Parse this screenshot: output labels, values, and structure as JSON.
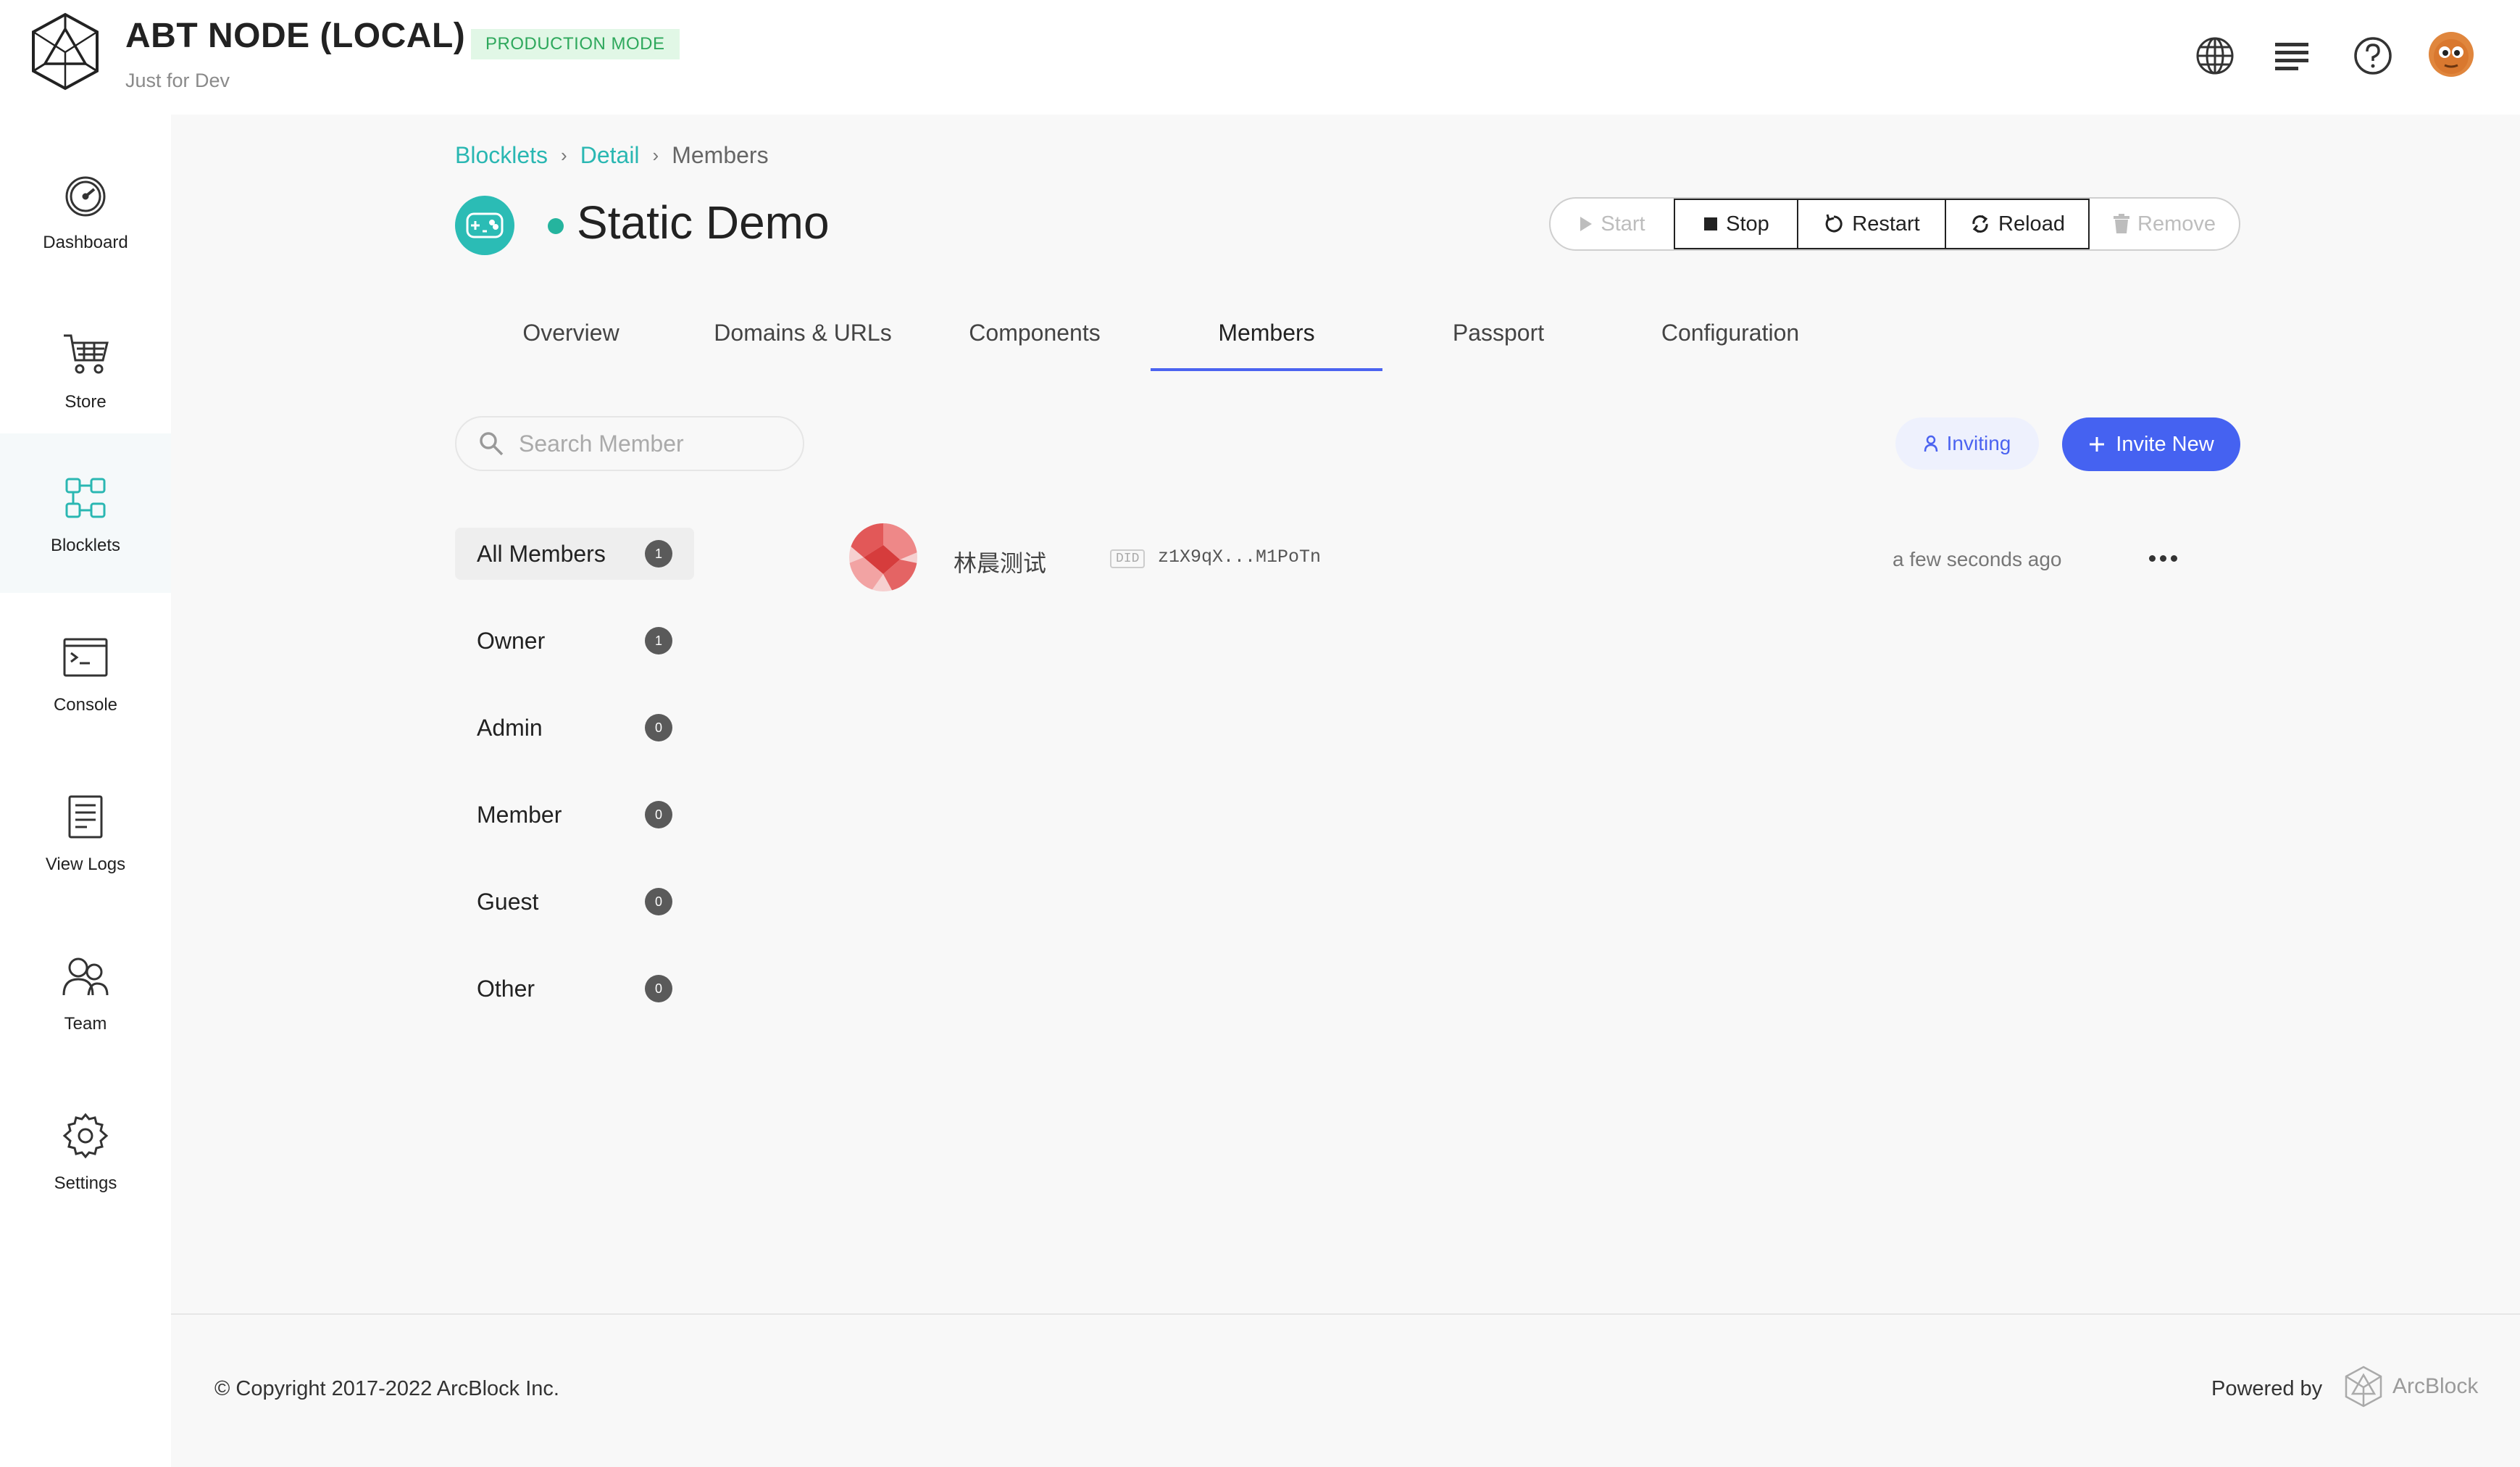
{
  "header": {
    "title": "ABT NODE (LOCAL)",
    "mode_badge": "PRODUCTION MODE",
    "subtitle": "Just for Dev",
    "icons": [
      "globe-icon",
      "list-icon",
      "help-icon",
      "user-avatar"
    ]
  },
  "sidebar": {
    "items": [
      {
        "label": "Dashboard",
        "icon": "dashboard-icon"
      },
      {
        "label": "Store",
        "icon": "cart-icon"
      },
      {
        "label": "Blocklets",
        "icon": "blocklets-icon",
        "active": true
      },
      {
        "label": "Console",
        "icon": "console-icon"
      },
      {
        "label": "View Logs",
        "icon": "logs-icon"
      },
      {
        "label": "Team",
        "icon": "team-icon"
      },
      {
        "label": "Settings",
        "icon": "gear-icon"
      }
    ]
  },
  "breadcrumb": {
    "items": [
      "Blocklets",
      "Detail"
    ],
    "current": "Members"
  },
  "app": {
    "title": "Static Demo",
    "status_color": "#25b49e",
    "icon": "gamepad-icon"
  },
  "actions": {
    "start": "Start",
    "stop": "Stop",
    "restart": "Restart",
    "reload": "Reload",
    "remove": "Remove"
  },
  "tabs": [
    "Overview",
    "Domains & URLs",
    "Components",
    "Members",
    "Passport",
    "Configuration"
  ],
  "active_tab": "Members",
  "search": {
    "placeholder": "Search Member",
    "value": ""
  },
  "buttons": {
    "inviting": "Inviting",
    "invite_new": "Invite New"
  },
  "roles": [
    {
      "label": "All Members",
      "count": "1",
      "active": true
    },
    {
      "label": "Owner",
      "count": "1"
    },
    {
      "label": "Admin",
      "count": "0"
    },
    {
      "label": "Member",
      "count": "0"
    },
    {
      "label": "Guest",
      "count": "0"
    },
    {
      "label": "Other",
      "count": "0"
    }
  ],
  "members": [
    {
      "name": "林晨测试",
      "did_badge": "DID",
      "did": "z1X9qX...M1PoTn",
      "time": "a few seconds ago"
    }
  ],
  "footer": {
    "copyright": "© Copyright 2017-2022  ArcBlock Inc.",
    "powered_by": "Powered by",
    "brand": "ArcBlock"
  },
  "colors": {
    "accent": "#4562f1",
    "teal": "#2ab7b2",
    "badge_bg": "#e1f7e6",
    "badge_text": "#2ea85c"
  }
}
